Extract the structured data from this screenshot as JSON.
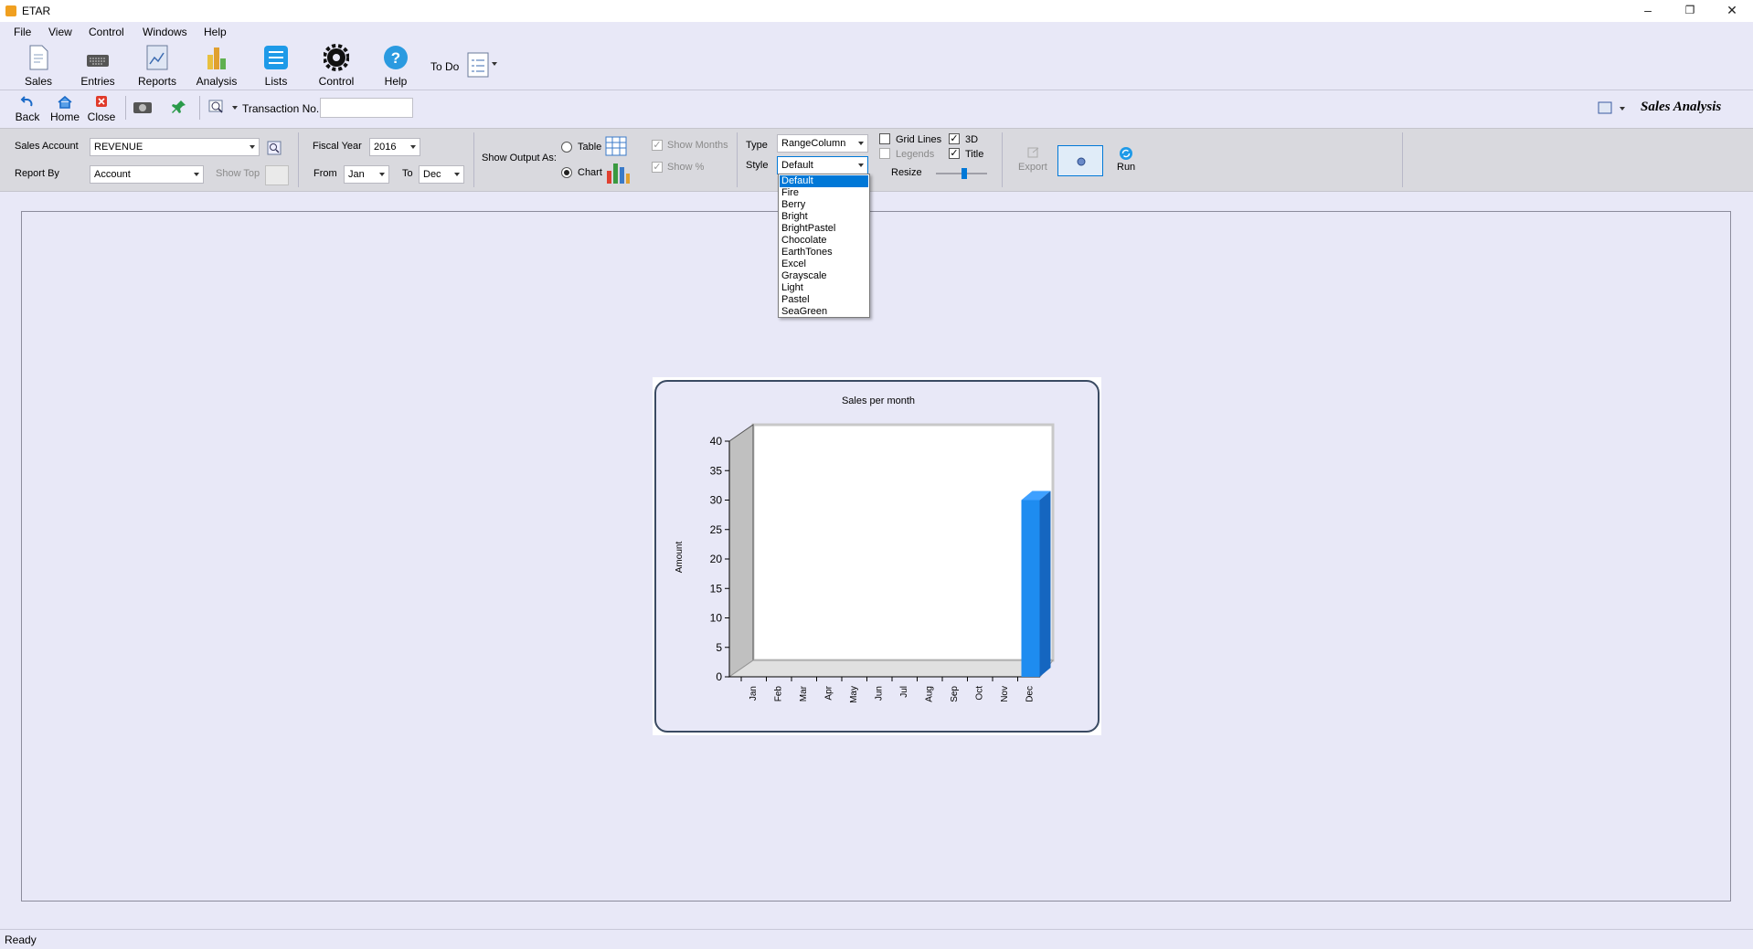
{
  "window": {
    "title": "ETAR",
    "minimize": "–",
    "restore": "❐",
    "close": "✕"
  },
  "menu": [
    "File",
    "View",
    "Control",
    "Windows",
    "Help"
  ],
  "ribbon": {
    "buttons": [
      {
        "label": "Sales",
        "icon": "sales-document-icon"
      },
      {
        "label": "Entries",
        "icon": "keyboard-icon"
      },
      {
        "label": "Reports",
        "icon": "report-icon"
      },
      {
        "label": "Analysis",
        "icon": "bar-analysis-icon"
      },
      {
        "label": "Lists",
        "icon": "list-icon"
      },
      {
        "label": "Control",
        "icon": "gear-icon"
      },
      {
        "label": "Help",
        "icon": "question-icon"
      }
    ],
    "todo_label": "To Do"
  },
  "nav": {
    "back": "Back",
    "home": "Home",
    "close": "Close",
    "transaction_label": "Transaction No.",
    "transaction_value": "",
    "page_title": "Sales Analysis"
  },
  "options": {
    "sales_account_label": "Sales Account",
    "sales_account_value": "REVENUE",
    "report_by_label": "Report By",
    "report_by_value": "Account",
    "show_top_label": "Show Top",
    "fiscal_year_label": "Fiscal Year",
    "fiscal_year_value": "2016",
    "from_label": "From",
    "from_value": "Jan",
    "to_label": "To",
    "to_value": "Dec",
    "show_output_label": "Show Output As:",
    "table_label": "Table",
    "chart_label": "Chart",
    "output_selected": "Chart",
    "show_months_label": "Show Months",
    "show_percent_label": "Show %",
    "type_label": "Type",
    "type_value": "RangeColumn",
    "style_label": "Style",
    "style_value": "Default",
    "grid_lines_label": "Grid Lines",
    "grid_lines_checked": false,
    "legends_label": "Legends",
    "legends_checked": false,
    "three_d_label": "3D",
    "three_d_checked": true,
    "title_label": "Title",
    "title_checked": true,
    "resize_label": "Resize",
    "resize_level": 0.55,
    "export_label": "Export",
    "run_label": "Run",
    "style_options": [
      "Default",
      "Fire",
      "Berry",
      "Bright",
      "BrightPastel",
      "Chocolate",
      "EarthTones",
      "Excel",
      "Grayscale",
      "Light",
      "Pastel",
      "SeaGreen"
    ],
    "style_selected_index": 0
  },
  "chart_data": {
    "type": "bar",
    "title": "Sales per month",
    "xlabel": "",
    "ylabel": "Amount",
    "categories": [
      "Jan",
      "Feb",
      "Mar",
      "Apr",
      "May",
      "Jun",
      "Jul",
      "Aug",
      "Sep",
      "Oct",
      "Nov",
      "Dec"
    ],
    "values": [
      0,
      0,
      0,
      0,
      0,
      0,
      0,
      0,
      0,
      0,
      0,
      30
    ],
    "ylim": [
      0,
      40
    ],
    "yticks": [
      0,
      5,
      10,
      15,
      20,
      25,
      30,
      35,
      40
    ],
    "grid": false,
    "three_d": true,
    "bar_color": "#1e8cf0"
  },
  "status": {
    "text": "Ready"
  },
  "colors": {
    "background": "#e8e8f7",
    "accent": "#0078d7",
    "options_panel": "#d9d9de"
  }
}
